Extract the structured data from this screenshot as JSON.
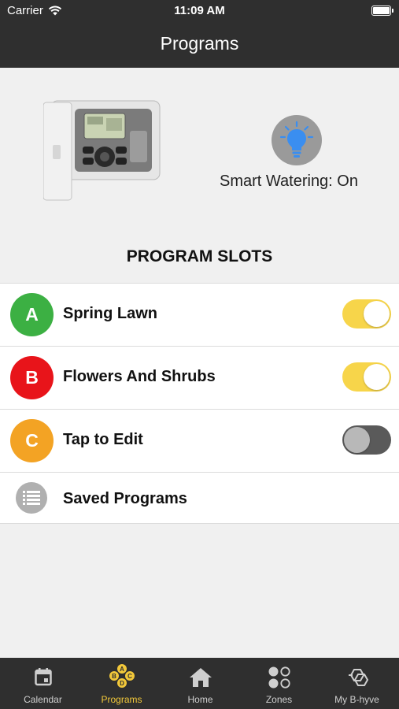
{
  "status_bar": {
    "carrier": "Carrier",
    "time": "11:09 AM"
  },
  "header": {
    "title": "Programs"
  },
  "hero": {
    "smart_watering": "Smart Watering: On"
  },
  "section": {
    "title": "PROGRAM SLOTS"
  },
  "programs": [
    {
      "letter": "A",
      "name": "Spring Lawn",
      "color": "#3cb043",
      "enabled": true
    },
    {
      "letter": "B",
      "name": "Flowers And Shrubs",
      "color": "#e8141a",
      "enabled": true
    },
    {
      "letter": "C",
      "name": "Tap to Edit",
      "color": "#f3a324",
      "enabled": false
    }
  ],
  "saved": {
    "label": "Saved Programs"
  },
  "tabs": [
    {
      "label": "Calendar",
      "icon": "calendar-icon",
      "active": false
    },
    {
      "label": "Programs",
      "icon": "programs-icon",
      "active": true
    },
    {
      "label": "Home",
      "icon": "home-icon",
      "active": false
    },
    {
      "label": "Zones",
      "icon": "zones-icon",
      "active": false
    },
    {
      "label": "My B-hyve",
      "icon": "b-hyve-icon",
      "active": false
    }
  ],
  "colors": {
    "accent": "#f2c83a",
    "toggle_on": "#f7d54a",
    "bulb": "#3a8ef0"
  }
}
